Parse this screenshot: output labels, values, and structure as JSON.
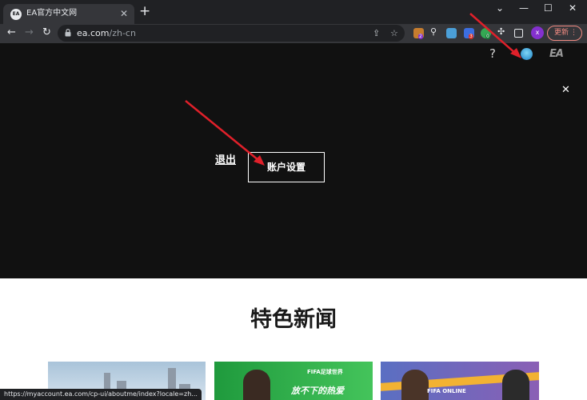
{
  "browser": {
    "tab": {
      "favicon_text": "EA",
      "title": "EA官方中文网",
      "close_glyph": "✕"
    },
    "new_tab_glyph": "+",
    "window_controls": {
      "chevron": "⌄",
      "minimize": "—",
      "maximize": "☐",
      "close": "✕"
    },
    "nav": {
      "back": "←",
      "forward": "→",
      "reload": "↻"
    },
    "address": {
      "host": "ea.com",
      "path": "/zh-cn"
    },
    "extension_badges": {
      "first": "2",
      "second": "3",
      "third": "0"
    },
    "profile_initial": "x",
    "update_button": {
      "label": "更新",
      "menu_glyph": "⋮"
    },
    "status_url": "https://myaccount.ea.com/cp-ui/aboutme/index?locale=zh..."
  },
  "site_header": {
    "help_glyph": "?",
    "logo_text": "EA"
  },
  "account_menu": {
    "close_glyph": "✕",
    "logout_label": "退出",
    "account_settings_label": "账户设置"
  },
  "featured": {
    "title": "特色新闻",
    "cards": [
      {
        "logo": "",
        "caption": ""
      },
      {
        "logo": "FIFA足球世界",
        "caption": "放不下的热爱"
      },
      {
        "logo": "FIFA ONLINE",
        "caption": ""
      }
    ]
  },
  "colors": {
    "overlay_bg": "#111111",
    "chrome_dark": "#202124",
    "chrome_toolbar": "#35363a",
    "annotation_arrow": "#e0202a",
    "update_accent": "#f28b82"
  }
}
